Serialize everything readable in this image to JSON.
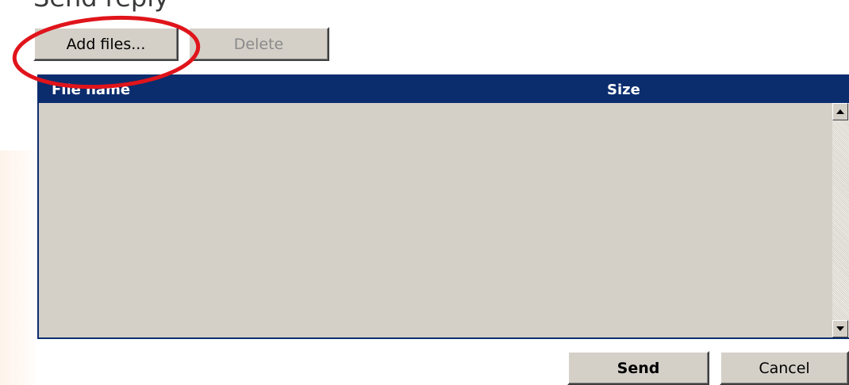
{
  "page": {
    "title": "Send reply"
  },
  "toolbar": {
    "add_files_label": "Add files...",
    "delete_label": "Delete"
  },
  "file_table": {
    "columns": [
      "File name",
      "Size"
    ],
    "rows": []
  },
  "footer": {
    "send_label": "Send",
    "cancel_label": "Cancel"
  },
  "annotation": {
    "highlight_color": "#e0141b",
    "highlighted_target": "add-files-button"
  },
  "colors": {
    "header_bg": "#0b2d6e",
    "button_face": "#d4d0c8"
  }
}
